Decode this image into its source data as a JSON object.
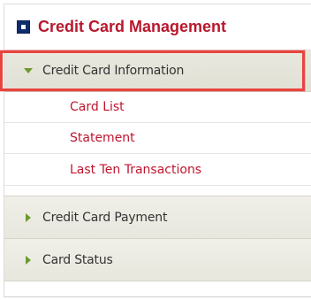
{
  "header": {
    "title": "Credit Card Management"
  },
  "sections": [
    {
      "label": "Credit Card Information",
      "expanded": true,
      "items": [
        {
          "label": "Card List"
        },
        {
          "label": "Statement"
        },
        {
          "label": "Last Ten Transactions"
        }
      ]
    },
    {
      "label": "Credit Card Payment",
      "expanded": false
    },
    {
      "label": "Card Status",
      "expanded": false
    }
  ],
  "colors": {
    "title": "#b8182d",
    "link": "#c0152e",
    "arrow": "#6c9a2f",
    "highlight_border": "#e8443f",
    "header_icon": "#0f2c6d"
  },
  "icons": {
    "header": "square-bullet-icon",
    "expanded": "caret-down-icon",
    "collapsed": "caret-right-icon"
  }
}
